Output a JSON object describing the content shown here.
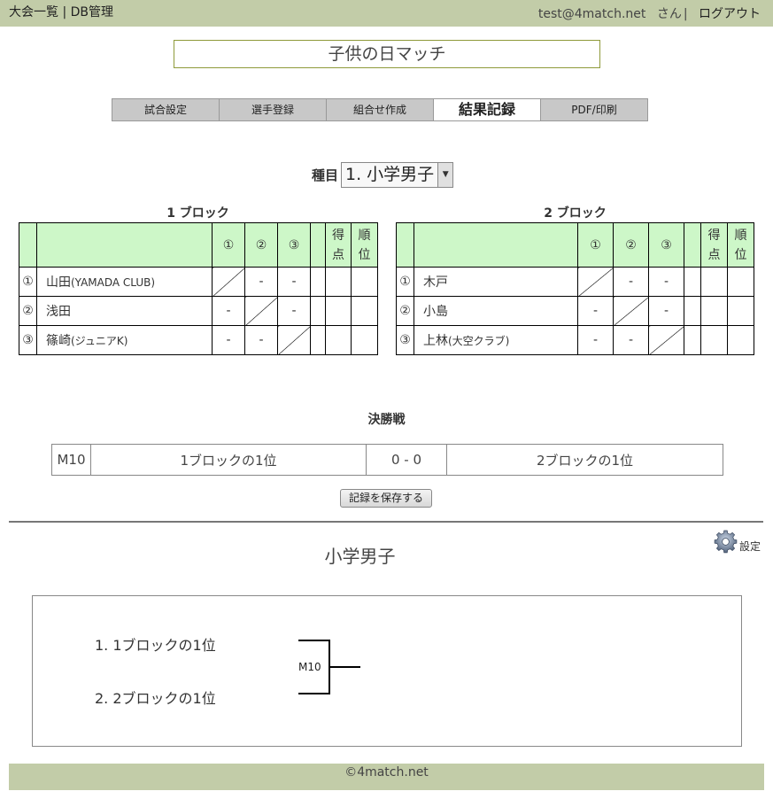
{
  "header": {
    "nav_tournaments": "大会一覧",
    "separator": "|",
    "nav_db": "DB管理",
    "user_email": "test@4match.net",
    "user_suffix": "さん",
    "separator2": "|",
    "logout": "ログアウト"
  },
  "tournament_title": "子供の日マッチ",
  "tabs": [
    {
      "label": "試合設定",
      "active": false
    },
    {
      "label": "選手登録",
      "active": false
    },
    {
      "label": "組合せ作成",
      "active": false
    },
    {
      "label": "結果記録",
      "active": true
    },
    {
      "label": "PDF/印刷",
      "active": false
    }
  ],
  "event_select": {
    "label": "種目",
    "value": "1. 小学男子"
  },
  "blocks": [
    {
      "title": "1 ブロック",
      "col_labels": [
        "①",
        "②",
        "③"
      ],
      "points_label": [
        "得",
        "点"
      ],
      "rank_label": [
        "順",
        "位"
      ],
      "rows": [
        {
          "num": "①",
          "name": "山田",
          "club": "(YAMADA CLUB)",
          "results": [
            "",
            "-",
            "-"
          ]
        },
        {
          "num": "②",
          "name": "浅田",
          "club": "",
          "results": [
            "-",
            "",
            "-"
          ]
        },
        {
          "num": "③",
          "name": "篠崎",
          "club": "(ジュニアK)",
          "results": [
            "-",
            "-",
            ""
          ]
        }
      ]
    },
    {
      "title": "2 ブロック",
      "col_labels": [
        "①",
        "②",
        "③"
      ],
      "points_label": [
        "得",
        "点"
      ],
      "rank_label": [
        "順",
        "位"
      ],
      "rows": [
        {
          "num": "①",
          "name": "木戸",
          "club": "",
          "results": [
            "",
            "-",
            "-"
          ]
        },
        {
          "num": "②",
          "name": "小島",
          "club": "",
          "results": [
            "-",
            "",
            "-"
          ]
        },
        {
          "num": "③",
          "name": "上林",
          "club": "(大空クラブ)",
          "results": [
            "-",
            "-",
            ""
          ]
        }
      ]
    }
  ],
  "final": {
    "title": "決勝戦",
    "match_id": "M10",
    "left": "1ブロックの1位",
    "score": "0 - 0",
    "right": "2ブロックの1位"
  },
  "save_button": "記録を保存する",
  "settings_label": "設定",
  "section_title": "小学男子",
  "bracket": {
    "entry1": "1. 1ブロックの1位",
    "entry2": "2. 2ブロックの1位",
    "match_label": "M10"
  },
  "footer": "©4match.net"
}
